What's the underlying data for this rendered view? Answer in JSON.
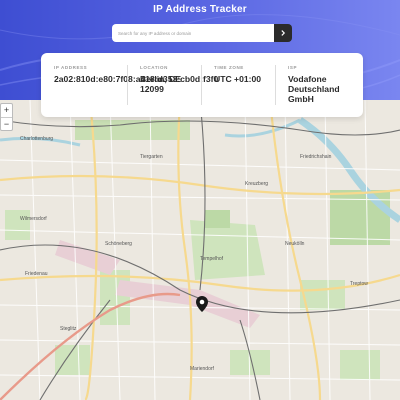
{
  "header": {
    "title": "IP Address Tracker"
  },
  "search": {
    "placeholder": "Search for any IP address or domain",
    "button_icon": "chevron-right-icon"
  },
  "info": {
    "ip": {
      "label": "IP ADDRESS",
      "value": "2a02:810d:e80:7f08:a418:d353:cb0d:f3f0"
    },
    "location": {
      "label": "LOCATION",
      "value": "Berlin, DE 12099"
    },
    "timezone": {
      "label": "TIME ZONE",
      "value": "UTC +01:00"
    },
    "isp": {
      "label": "ISP",
      "value": "Vodafone Deutschland GmbH"
    }
  },
  "map": {
    "zoom_in": "+",
    "zoom_out": "−",
    "marker_icon": "location-pin-icon",
    "labels": [
      "Tiergarten",
      "Friedrichshain",
      "Kreuzberg",
      "Tempelhof",
      "Neukölln",
      "Schöneberg",
      "Wilmersdorf",
      "Charlottenburg",
      "Steglitz",
      "Friedenau",
      "Treptow",
      "Mariendorf"
    ]
  },
  "colors": {
    "accent": "#4a59d8",
    "button": "#2b2b2b",
    "marker": "#1a1a1a"
  }
}
